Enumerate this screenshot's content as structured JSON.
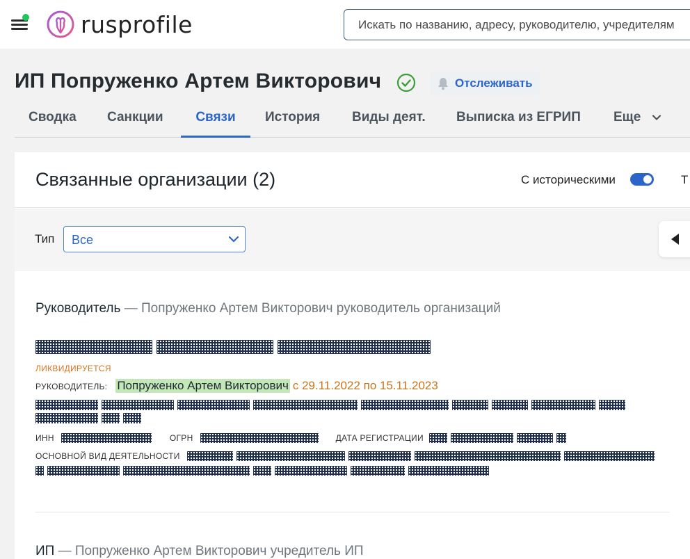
{
  "header": {
    "logo_text": "rusprofile",
    "search_placeholder": "Искать по названию, адресу, руководителю, учредителям"
  },
  "entity": {
    "title": "ИП Попруженко Артем Викторович",
    "follow_label": "Отслеживать"
  },
  "tabs": [
    {
      "label": "Сводка"
    },
    {
      "label": "Санкции"
    },
    {
      "label": "Связи",
      "active": true
    },
    {
      "label": "История"
    },
    {
      "label": "Виды деят."
    },
    {
      "label": "Выписка из ЕГРИП"
    },
    {
      "label": "Еще"
    }
  ],
  "card": {
    "title": "Связанные организации (2)",
    "historic_label": "С историческими",
    "historic_enabled": true,
    "cut_label": "Т",
    "filter_label": "Тип",
    "filter_value": "Все"
  },
  "sections": [
    {
      "role": "Руководитель",
      "dash": "—",
      "desc": "Попруженко Артем Викторович руководитель организаций",
      "status": "ЛИКВИДИРУЕТСЯ",
      "manager_label": "РУКОВОДИТЕЛЬ:",
      "manager_name": "Попруженко Артем Викторович",
      "manager_period": "с 29.11.2022 по 15.11.2023",
      "inn_label": "ИНН",
      "ogrn_label": "ОГРН",
      "reg_label": "ДАТА РЕГИСТРАЦИИ",
      "activity_label": "ОСНОВНОЙ ВИД ДЕЯТЕЛЬНОСТИ"
    },
    {
      "role": "ИП",
      "dash": "—",
      "desc": "Попруженко Артем Викторович учредитель ИП"
    }
  ],
  "colors": {
    "accent": "#2c65c9",
    "status_orange": "#d9731f",
    "highlight_green": "#c4e7b8",
    "verified_green": "#3a9d3a"
  }
}
